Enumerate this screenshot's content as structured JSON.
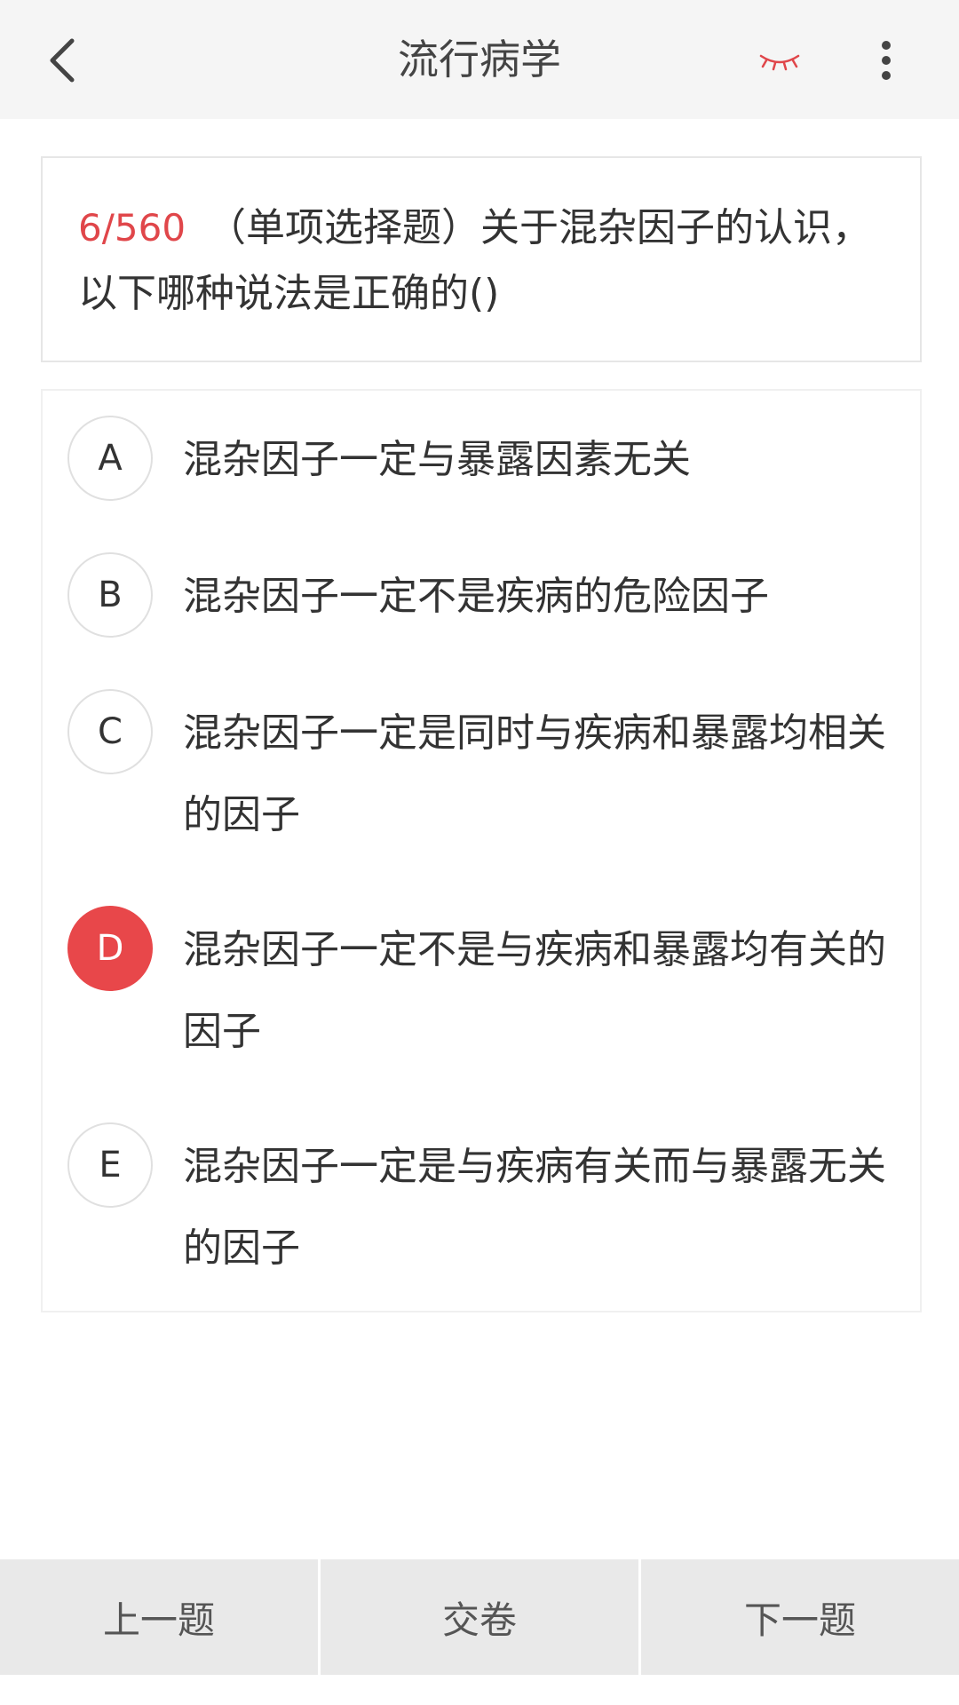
{
  "header": {
    "title": "流行病学",
    "back_icon": "chevron-left-icon",
    "eye_icon": "eye-closed-icon",
    "more_icon": "more-vertical-icon",
    "eye_color": "#e0464a"
  },
  "question": {
    "counter": "6/560",
    "text": "（单项选择题）关于混杂因子的认识，以下哪种说法是正确的()"
  },
  "options": [
    {
      "letter": "A",
      "text": "混杂因子一定与暴露因素无关",
      "selected": false
    },
    {
      "letter": "B",
      "text": "混杂因子一定不是疾病的危险因子",
      "selected": false
    },
    {
      "letter": "C",
      "text": "混杂因子一定是同时与疾病和暴露均相关的因子",
      "selected": false
    },
    {
      "letter": "D",
      "text": "混杂因子一定不是与疾病和暴露均有关的因子",
      "selected": true
    },
    {
      "letter": "E",
      "text": "混杂因子一定是与疾病有关而与暴露无关的因子",
      "selected": false
    }
  ],
  "footer": {
    "prev_label": "上一题",
    "submit_label": "交卷",
    "next_label": "下一题"
  },
  "colors": {
    "accent": "#e8474a",
    "header_bg": "#f5f5f5",
    "footer_bg": "#e9e9e9"
  }
}
